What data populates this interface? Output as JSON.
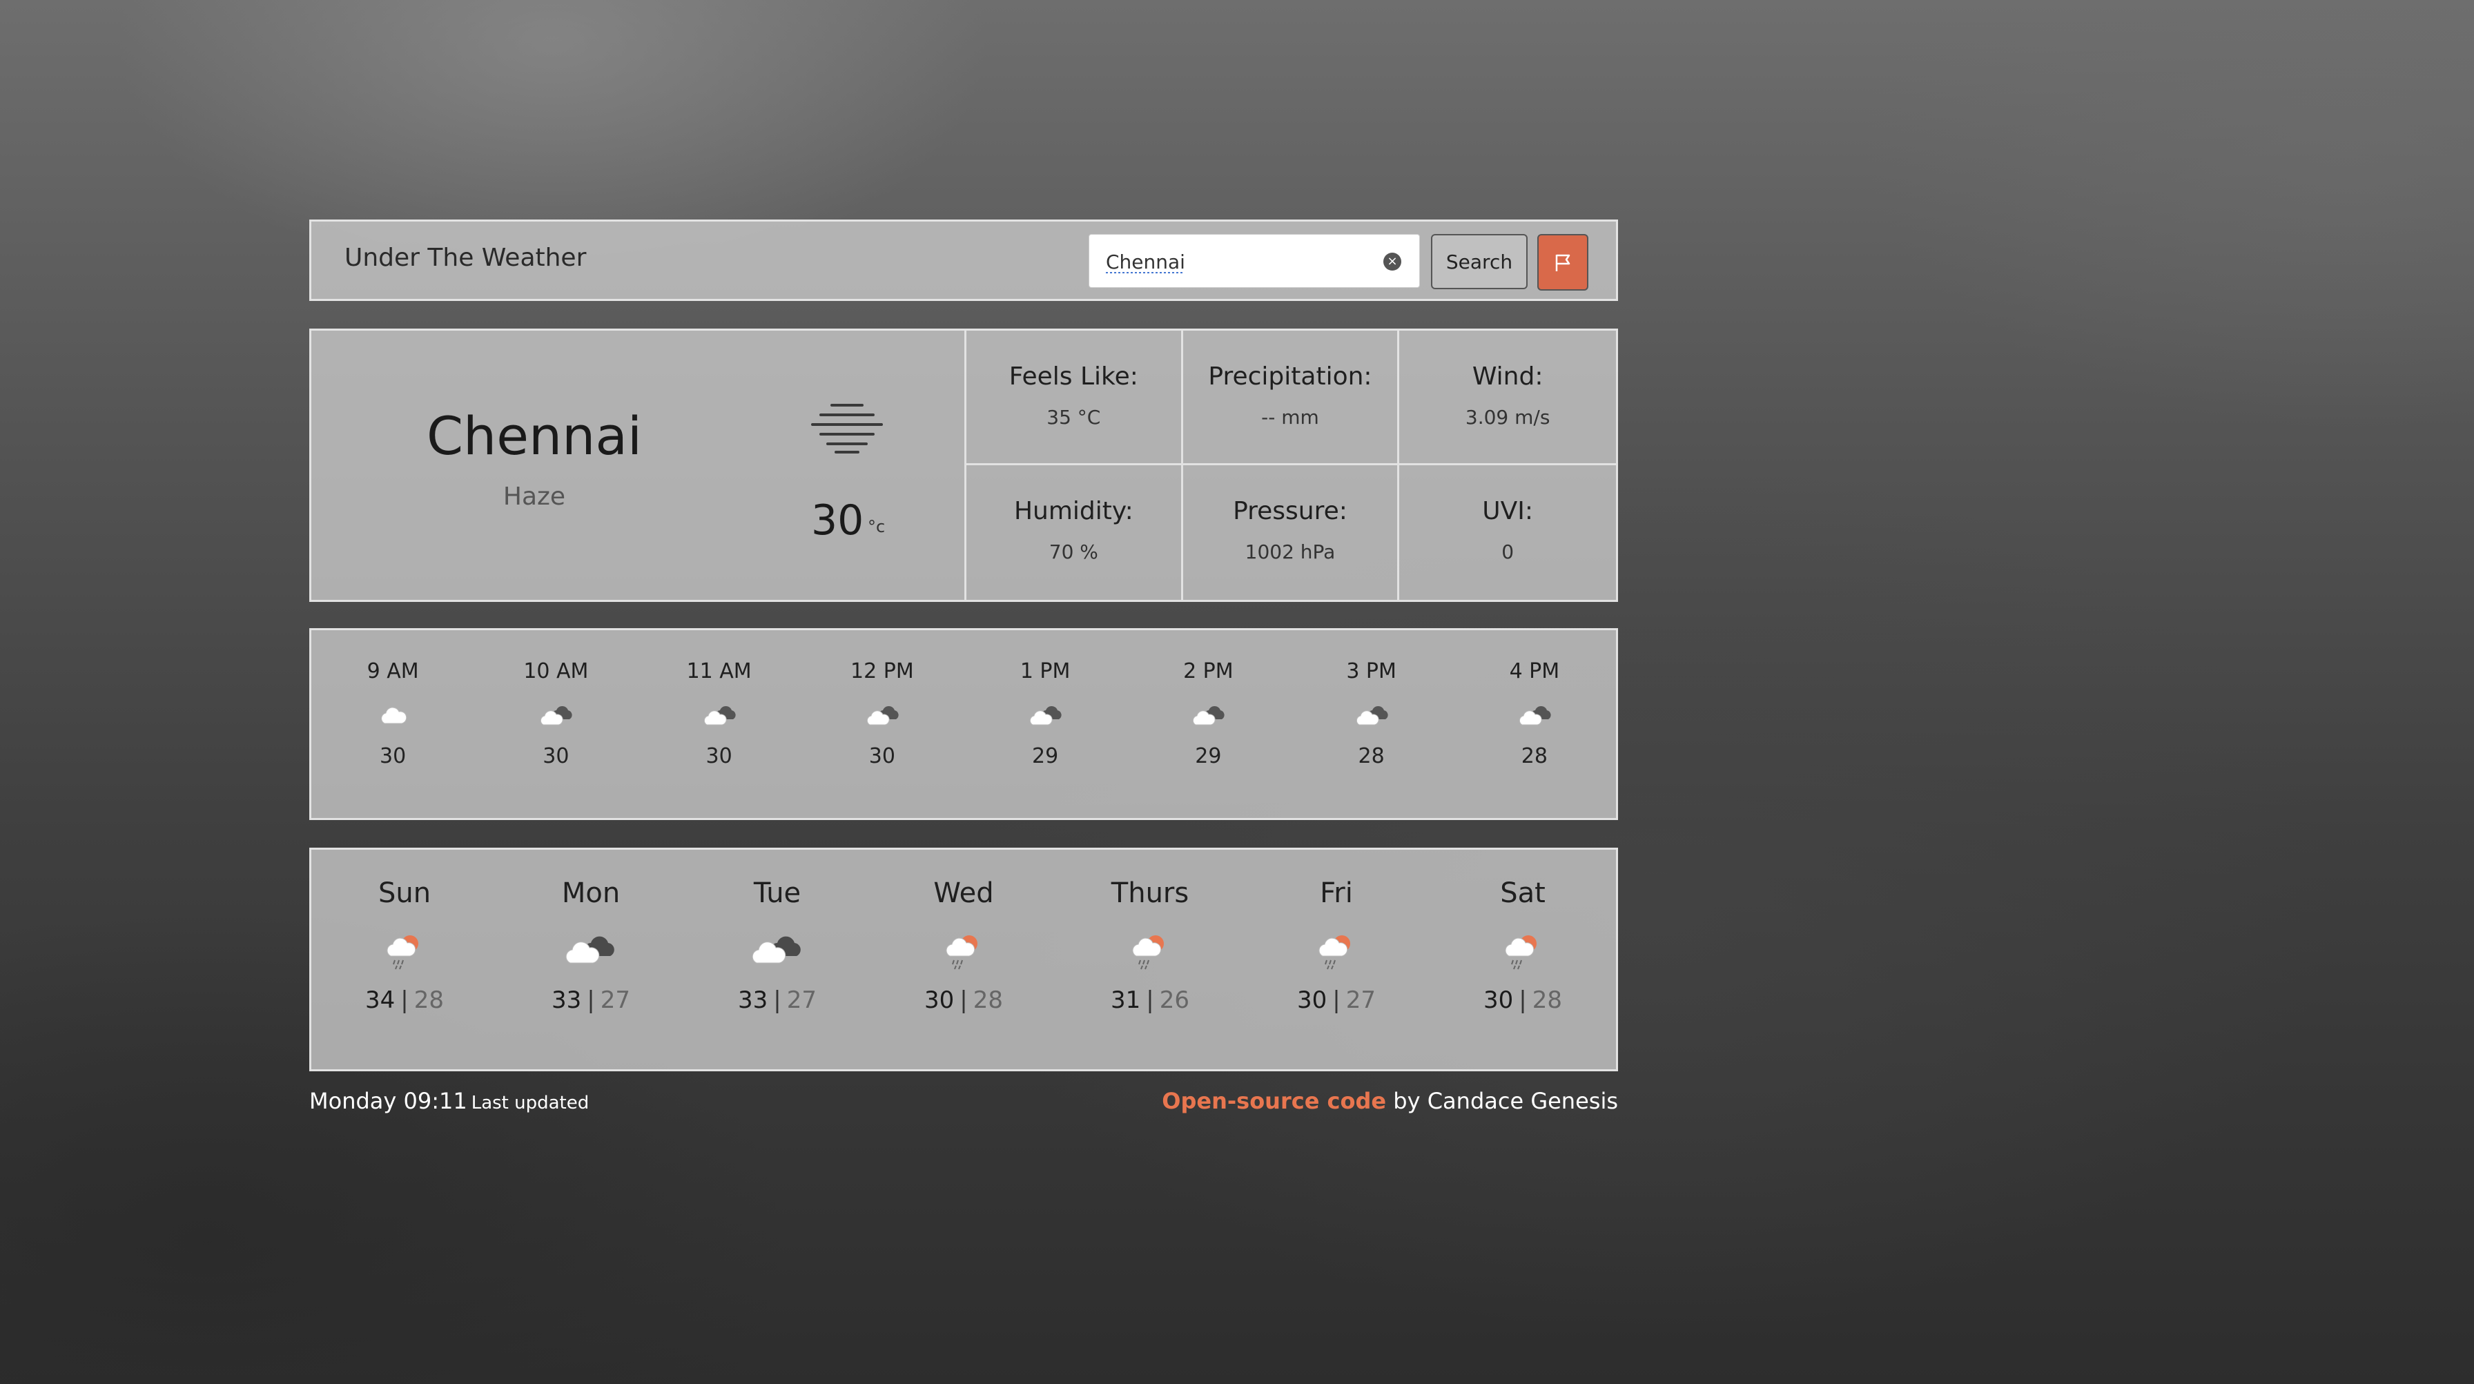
{
  "header": {
    "title": "Under The Weather",
    "search_value": "Chennai",
    "search_button_label": "Search",
    "flag_icon": "flag-icon",
    "accent_color": "#d9694a"
  },
  "current": {
    "city": "Chennai",
    "condition": "Haze",
    "condition_icon": "haze-icon",
    "temperature": "30",
    "unit": "°c",
    "stats": [
      {
        "label": "Feels Like:",
        "value": "35 °C"
      },
      {
        "label": "Precipitation:",
        "value": "-- mm"
      },
      {
        "label": "Wind:",
        "value": "3.09 m/s"
      },
      {
        "label": "Humidity:",
        "value": "70 %"
      },
      {
        "label": "Pressure:",
        "value": "1002 hPa"
      },
      {
        "label": "UVI:",
        "value": "0"
      }
    ]
  },
  "hourly": [
    {
      "time": "9 AM",
      "icon": "cloud-icon",
      "temp": "30"
    },
    {
      "time": "10 AM",
      "icon": "broken-clouds-icon",
      "temp": "30"
    },
    {
      "time": "11 AM",
      "icon": "broken-clouds-icon",
      "temp": "30"
    },
    {
      "time": "12 PM",
      "icon": "broken-clouds-icon",
      "temp": "30"
    },
    {
      "time": "1 PM",
      "icon": "broken-clouds-icon",
      "temp": "29"
    },
    {
      "time": "2 PM",
      "icon": "broken-clouds-icon",
      "temp": "29"
    },
    {
      "time": "3 PM",
      "icon": "broken-clouds-icon",
      "temp": "28"
    },
    {
      "time": "4 PM",
      "icon": "broken-clouds-icon",
      "temp": "28"
    }
  ],
  "daily": [
    {
      "day": "Sun",
      "icon": "sun-rain-icon",
      "high": "34",
      "low": "28"
    },
    {
      "day": "Mon",
      "icon": "broken-clouds-icon",
      "high": "33",
      "low": "27"
    },
    {
      "day": "Tue",
      "icon": "broken-clouds-icon",
      "high": "33",
      "low": "27"
    },
    {
      "day": "Wed",
      "icon": "sun-rain-icon",
      "high": "30",
      "low": "28"
    },
    {
      "day": "Thurs",
      "icon": "sun-rain-icon",
      "high": "31",
      "low": "26"
    },
    {
      "day": "Fri",
      "icon": "sun-rain-icon",
      "high": "30",
      "low": "27"
    },
    {
      "day": "Sat",
      "icon": "sun-rain-icon",
      "high": "30",
      "low": "28"
    }
  ],
  "footer": {
    "updated_time": "Monday 09:11",
    "updated_label": "Last updated",
    "link_text": "Open-source code",
    "byline": "by Candace Genesis"
  }
}
